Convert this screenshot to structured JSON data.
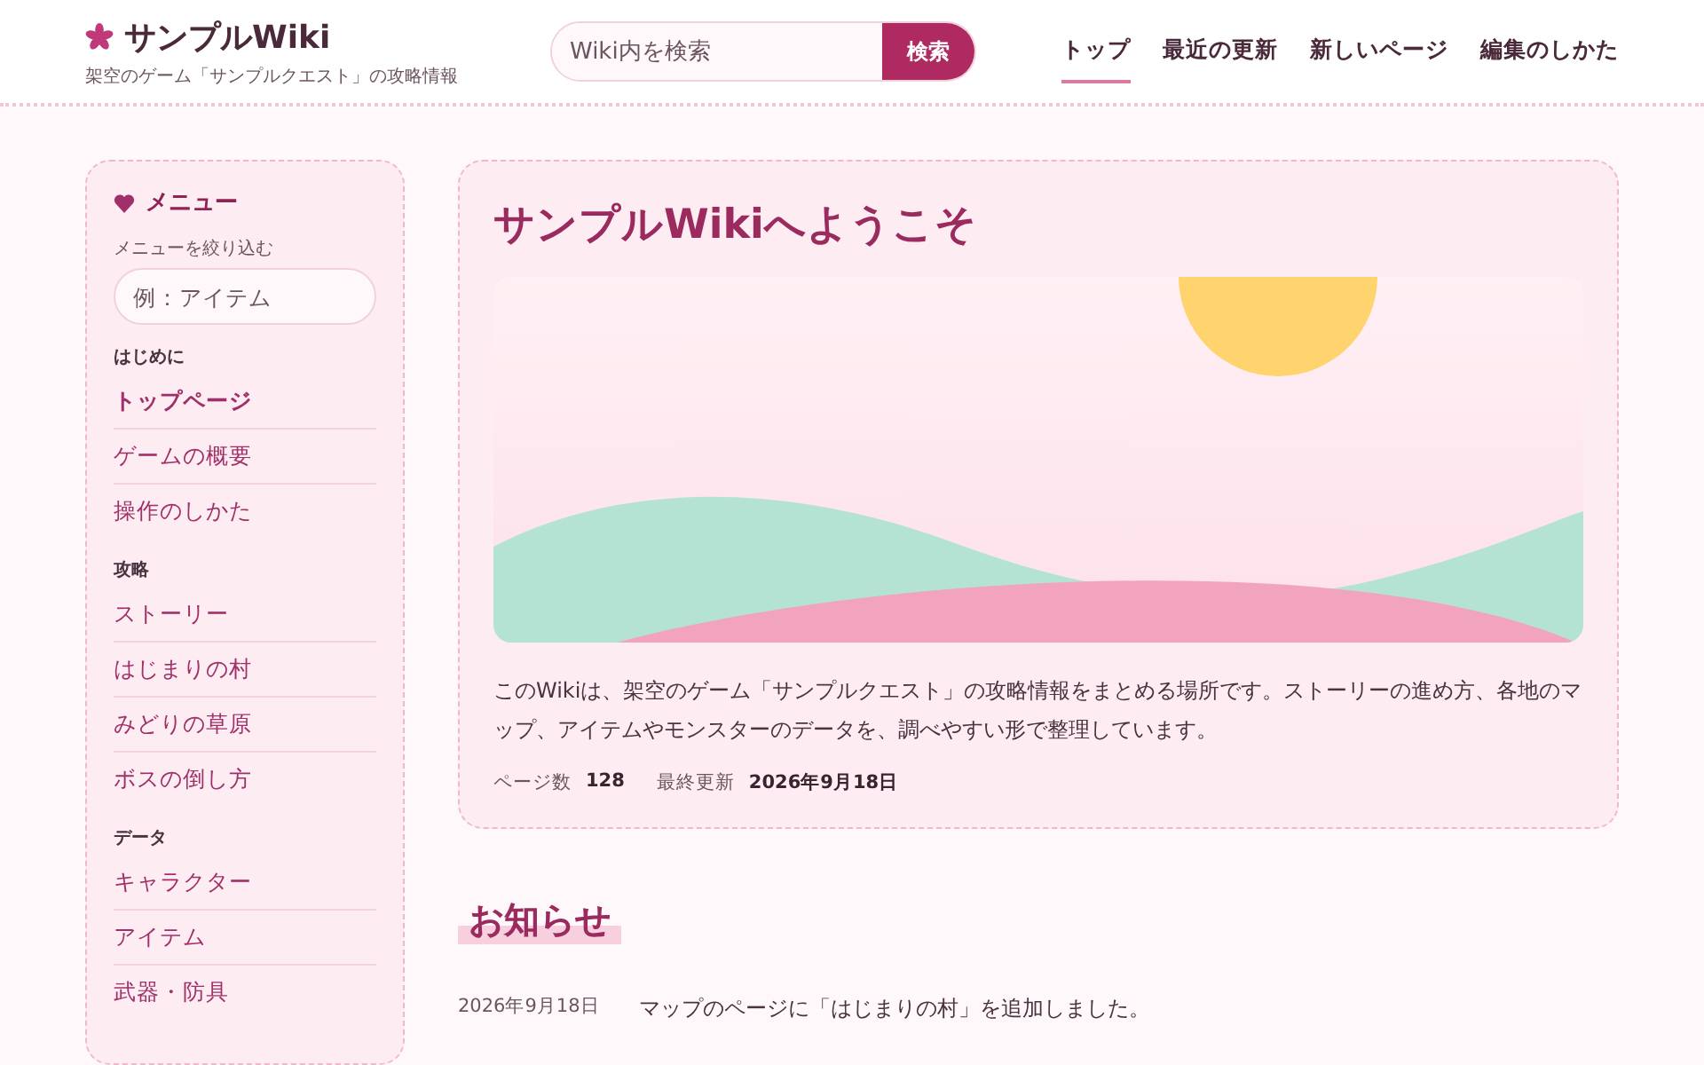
{
  "site": {
    "title": "サンプルWiki",
    "tagline": "架空のゲーム「サンプルクエスト」の攻略情報"
  },
  "search": {
    "placeholder": "Wiki内を検索",
    "button": "検索"
  },
  "nav": [
    {
      "label": "トップ",
      "selected": true
    },
    {
      "label": "最近の更新",
      "selected": false
    },
    {
      "label": "新しいページ",
      "selected": false
    },
    {
      "label": "編集のしかた",
      "selected": false
    }
  ],
  "sidebar": {
    "title": "メニュー",
    "filter_label": "メニューを絞り込む",
    "filter_placeholder": "例：アイテム",
    "sections": [
      {
        "heading": "はじめに",
        "items": [
          {
            "label": "トップページ",
            "selected": true
          },
          {
            "label": "ゲームの概要",
            "selected": false
          },
          {
            "label": "操作のしかた",
            "selected": false
          }
        ]
      },
      {
        "heading": "攻略",
        "items": [
          {
            "label": "ストーリー",
            "selected": false
          },
          {
            "label": "はじまりの村",
            "selected": false
          },
          {
            "label": "みどりの草原",
            "selected": false
          },
          {
            "label": "ボスの倒し方",
            "selected": false
          }
        ]
      },
      {
        "heading": "データ",
        "items": [
          {
            "label": "キャラクター",
            "selected": false
          },
          {
            "label": "アイテム",
            "selected": false
          },
          {
            "label": "武器・防具",
            "selected": false
          }
        ]
      }
    ]
  },
  "hero": {
    "title": "サンプルWikiへようこそ",
    "text": "このWikiは、架空のゲーム「サンプルクエスト」の攻略情報をまとめる場所です。ストーリーの進め方、各地のマップ、アイテムやモンスターのデータを、調べやすい形で整理しています。",
    "stats": [
      {
        "label": "ページ数",
        "value": "128"
      },
      {
        "label": "最終更新",
        "value": "2026年9月18日"
      }
    ]
  },
  "news": {
    "heading": "お知らせ",
    "items": [
      {
        "date": "2026年9月18日",
        "text": "マップのページに「はじまりの村」を追加しました。"
      }
    ]
  }
}
